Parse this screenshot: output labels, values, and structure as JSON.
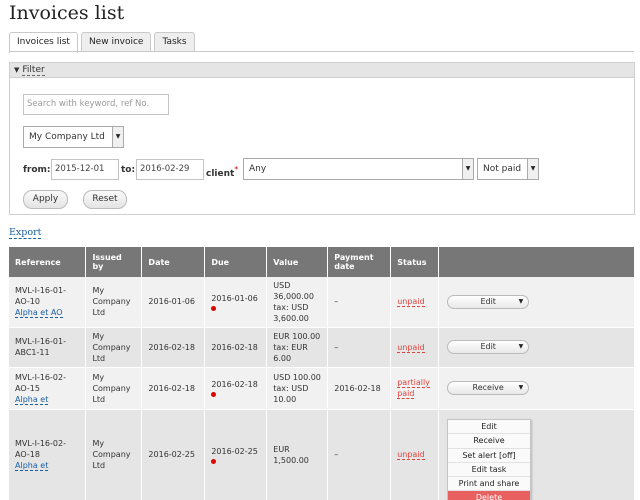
{
  "page": {
    "title": "Invoices list"
  },
  "tabs": [
    "Invoices list",
    "New invoice",
    "Tasks"
  ],
  "filter": {
    "title": "Filter",
    "search_placeholder": "Search with keyword, ref No.",
    "company": "My Company Ltd",
    "from_label": "from:",
    "from_value": "2015-12-01",
    "to_label": "to:",
    "to_value": "2016-02-29",
    "client_label": "client",
    "required_mark": "*",
    "client_value": "Any",
    "paid_value": "Not paid",
    "apply_label": "Apply",
    "reset_label": "Reset"
  },
  "export_label": "Export",
  "table": {
    "headers": [
      "Reference",
      "Issued by",
      "Date",
      "Due",
      "Value",
      "Payment date",
      "Status",
      ""
    ],
    "rows": [
      {
        "ref": "MVL-I-16-01-AO-10",
        "client": "Alpha et AO",
        "issued_by": "My Company Ltd",
        "date": "2016-01-06",
        "due": "2016-01-06",
        "overdue": true,
        "value": "USD 36,000.00 tax: USD 3,600.00",
        "payment_date": "–",
        "status": "unpaid",
        "action": "Edit"
      },
      {
        "ref": "MVL-I-16-01-ABC1-11",
        "client": "",
        "issued_by": "My Company Ltd",
        "date": "2016-02-18",
        "due": "2016-02-18",
        "overdue": false,
        "value": "EUR 100.00 tax: EUR 6.00",
        "payment_date": "–",
        "status": "unpaid",
        "action": "Edit"
      },
      {
        "ref": "MVL-I-16-02-AO-15",
        "client": "Alpha et",
        "issued_by": "My Company Ltd",
        "date": "2016-02-18",
        "due": "2016-02-18",
        "overdue": true,
        "value": "USD 100.00 tax: USD 10.00",
        "payment_date": "2016-02-18",
        "status": "partially paid",
        "action": "Receive"
      },
      {
        "ref": "MVL-I-16-02-AO-18",
        "client": "Alpha et",
        "issued_by": "My Company Ltd",
        "date": "2016-02-25",
        "due": "2016-02-25",
        "overdue": true,
        "value": "EUR 1,500.00",
        "payment_date": "–",
        "status": "unpaid",
        "action": ""
      }
    ]
  },
  "dropdown": {
    "items": [
      "Edit",
      "Receive",
      "Set alert [off]",
      "Edit task",
      "Print and share",
      "Delete"
    ]
  }
}
